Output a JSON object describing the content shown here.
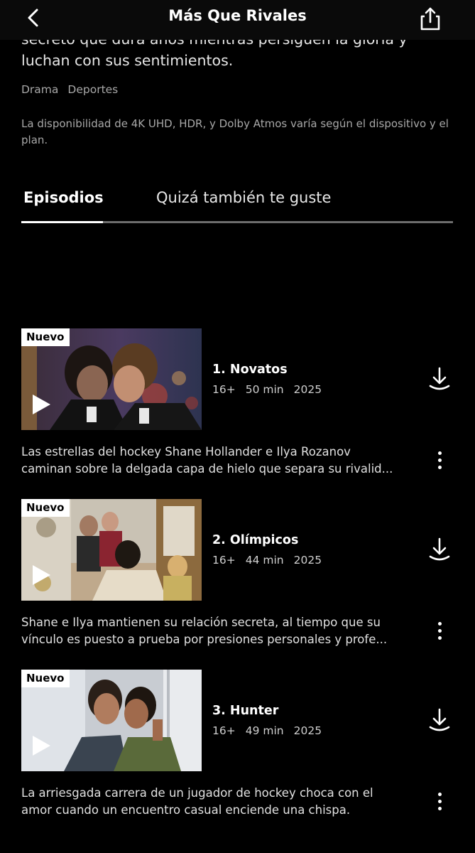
{
  "header": {
    "title": "Más Que Rivales",
    "back_icon": "chevron-left-icon",
    "share_icon": "share-icon"
  },
  "details": {
    "synopsis_line1": "secreto que dura años mientras persiguen la gloria y",
    "synopsis_line2": "luchan con sus sentimientos.",
    "genres": [
      "Drama",
      "Deportes"
    ],
    "availability": "La disponibilidad de 4K UHD, HDR, y Dolby Atmos varía según el dispositivo y el plan."
  },
  "tabs": [
    {
      "label": "Episodios",
      "selected": true
    },
    {
      "label": "Quizá también te guste",
      "selected": false
    }
  ],
  "episodes": [
    {
      "badge": "Nuevo",
      "title": "1. Novatos",
      "rating": "16+",
      "duration": "50 min",
      "year": "2025",
      "desc_line1": "Las estrellas del hockey Shane Hollander e Ilya Rozanov",
      "desc_line2": "caminan sobre la delgada capa de hielo que separa su rivalid..."
    },
    {
      "badge": "Nuevo",
      "title": "2. Olímpicos",
      "rating": "16+",
      "duration": "44 min",
      "year": "2025",
      "desc_line1": "Shane e Ilya mantienen su relación secreta, al tiempo que su",
      "desc_line2": "vínculo es puesto a prueba por presiones personales y profe..."
    },
    {
      "badge": "Nuevo",
      "title": "3. Hunter",
      "rating": "16+",
      "duration": "49 min",
      "year": "2025",
      "desc_line1": "La arriesgada carrera de un jugador de hockey choca con el",
      "desc_line2": "amor cuando un encuentro casual enciende una chispa."
    }
  ]
}
